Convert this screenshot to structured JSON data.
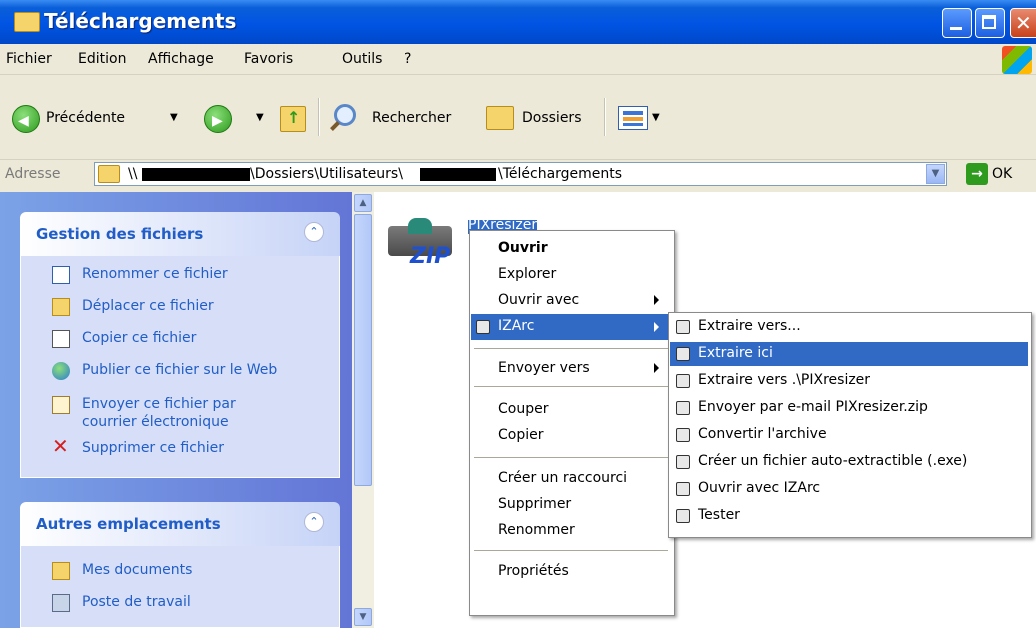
{
  "window": {
    "title": "Téléchargements"
  },
  "menubar": [
    "Fichier",
    "Edition",
    "Affichage",
    "Favoris",
    "Outils",
    "?"
  ],
  "toolbar": {
    "back": "Précédente",
    "search": "Rechercher",
    "folders": "Dossiers"
  },
  "address": {
    "label": "Adresse",
    "path_prefix": "\\\\",
    "path_part1": "\\Dossiers\\Utilisateurs\\",
    "path_part2": "\\Téléchargements",
    "go": "OK"
  },
  "tasks": {
    "title": "Gestion des fichiers",
    "items": [
      "Renommer ce fichier",
      "Déplacer ce fichier",
      "Copier ce fichier",
      "Publier ce fichier sur le Web",
      "Envoyer ce fichier par",
      "courrier électronique",
      "Supprimer ce fichier"
    ]
  },
  "places": {
    "title": "Autres emplacements",
    "items": [
      "Mes documents",
      "Poste de travail"
    ]
  },
  "file": {
    "name": "PIXresizer",
    "icon": "zip-archive-icon"
  },
  "context_menu": {
    "items": [
      "Ouvrir",
      "Explorer",
      "Ouvrir avec",
      "IZArc",
      "Envoyer vers",
      "Couper",
      "Copier",
      "Créer un raccourci",
      "Supprimer",
      "Renommer",
      "Propriétés"
    ]
  },
  "izarc_submenu": {
    "items": [
      "Extraire vers...",
      "Extraire ici",
      "Extraire vers .\\PIXresizer",
      "Envoyer par e-mail PIXresizer.zip",
      "Convertir l'archive",
      "Créer un fichier auto-extractible (.exe)",
      "Ouvrir avec IZArc",
      "Tester"
    ]
  },
  "colors": {
    "titlebar": "#0054e3",
    "highlight": "#316ac5",
    "task_link": "#215dc6"
  }
}
